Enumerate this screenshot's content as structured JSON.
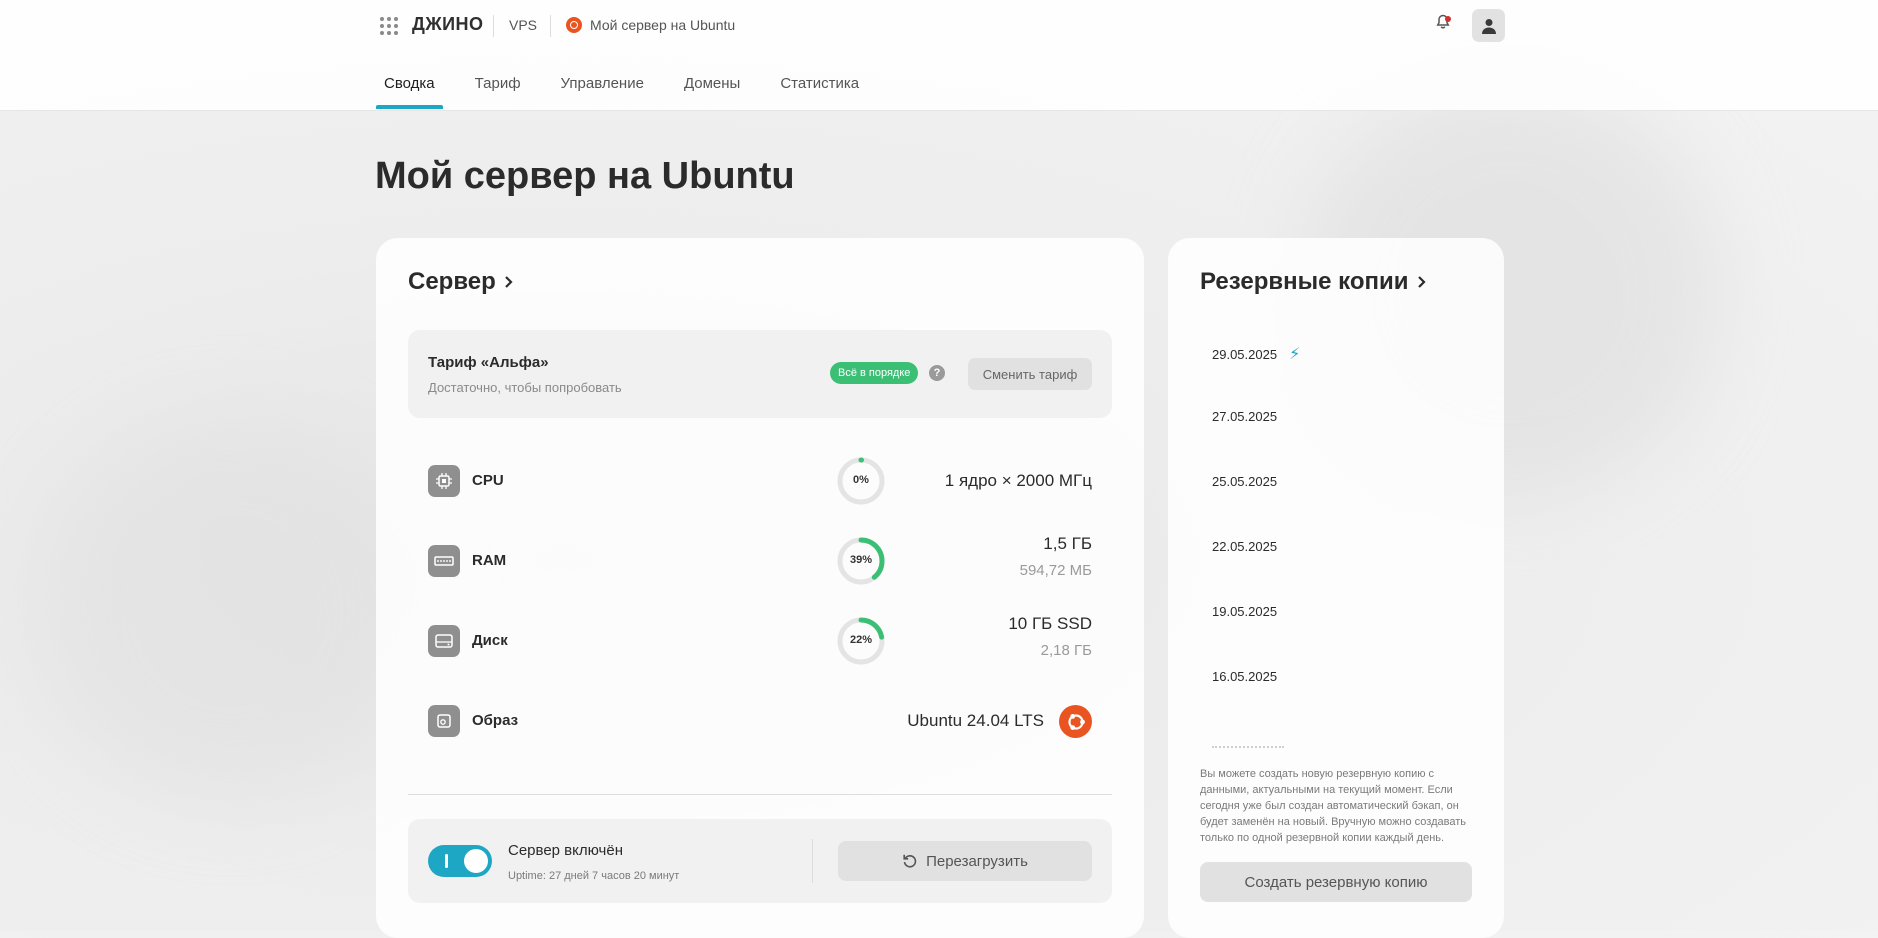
{
  "header": {
    "logo": "ДЖИНО",
    "breadcrumb_vps": "VPS",
    "breadcrumb_server": "Мой сервер на Ubuntu"
  },
  "tabs": [
    {
      "label": "Сводка"
    },
    {
      "label": "Тариф"
    },
    {
      "label": "Управление"
    },
    {
      "label": "Домены"
    },
    {
      "label": "Статистика"
    }
  ],
  "page_title": "Мой сервер на Ubuntu",
  "server": {
    "title": "Сервер",
    "tariff": {
      "name": "Тариф «Альфа»",
      "description": "Достаточно, чтобы попробовать",
      "status": "Всё в порядке",
      "help": "?",
      "change_button": "Сменить тариф"
    },
    "resources": [
      {
        "label": "CPU",
        "gauge_label": "0%",
        "percent": 0,
        "value": "1 ядро × 2000 МГц",
        "sub": ""
      },
      {
        "label": "RAM",
        "gauge_label": "39%",
        "percent": 39,
        "value": "1,5 ГБ",
        "sub": "594,72 МБ"
      },
      {
        "label": "Диск",
        "gauge_label": "22%",
        "percent": 22,
        "value": "10 ГБ SSD",
        "sub": "2,18 ГБ"
      },
      {
        "label": "Образ",
        "value": "Ubuntu 24.04 LTS"
      }
    ],
    "power": {
      "title": "Сервер включён",
      "uptime": "Uptime: 27 дней 7 часов 20 минут",
      "reboot_button": "Перезагрузить",
      "enabled": true
    }
  },
  "backups": {
    "title": "Резервные копии",
    "items": [
      {
        "date": "29.05.2025",
        "icon": "bolt-icon"
      },
      {
        "date": "27.05.2025"
      },
      {
        "date": "25.05.2025"
      },
      {
        "date": "22.05.2025"
      },
      {
        "date": "19.05.2025"
      },
      {
        "date": "16.05.2025"
      }
    ],
    "note": "Вы можете создать новую резервную копию с данными, актуальными на текущий момент. Если сегодня уже был создан автоматический бэкап, он будет заменён на новый. Вручную можно создавать только по одной резервной копии каждый день.",
    "create_button": "Создать резервную копию"
  },
  "colors": {
    "accent": "#1ea7c4",
    "success": "#3bbf74",
    "ubuntu": "#e95420"
  }
}
